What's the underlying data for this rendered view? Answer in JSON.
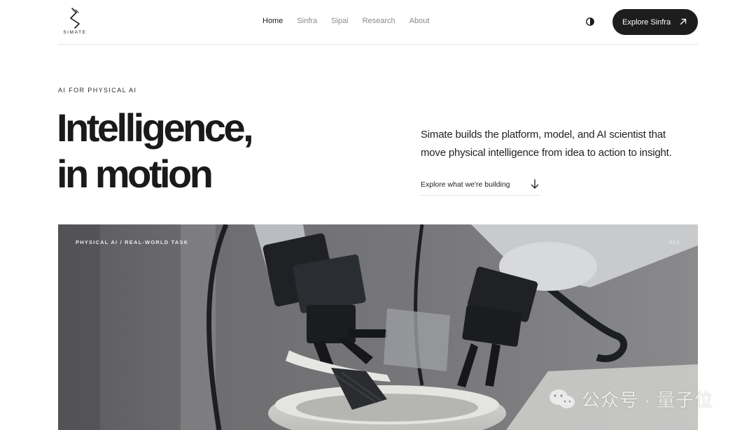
{
  "brand": {
    "name": "SIMATE"
  },
  "nav": {
    "items": [
      {
        "label": "Home",
        "active": true
      },
      {
        "label": "Sinfra",
        "active": false
      },
      {
        "label": "Sipai",
        "active": false
      },
      {
        "label": "Research",
        "active": false
      },
      {
        "label": "About",
        "active": false
      }
    ]
  },
  "header": {
    "theme_toggle_icon": "contrast-icon",
    "cta_label": "Explore Sinfra",
    "cta_icon": "arrow-up-right-icon"
  },
  "hero": {
    "eyebrow": "AI FOR PHYSICAL AI",
    "headline_line1": "Intelligence,",
    "headline_line2": "in motion",
    "description": "Simate builds the platform, model, and AI scientist that move physical intelligence from idea to action to insight.",
    "explore_label": "Explore what we're building",
    "explore_icon": "arrow-down-icon"
  },
  "media": {
    "caption": "PHYSICAL AI / REAL-WORLD TASK",
    "index": "001",
    "alt": "robot-arms-cleaning-icon"
  },
  "watermark": {
    "text": "公众号 · 量子位",
    "icon": "wechat-icon"
  },
  "colors": {
    "cta_bg": "#1d1d1d",
    "text": "#1a1a1a",
    "muted": "#8a8a8a",
    "divider": "#e6e6e6"
  }
}
